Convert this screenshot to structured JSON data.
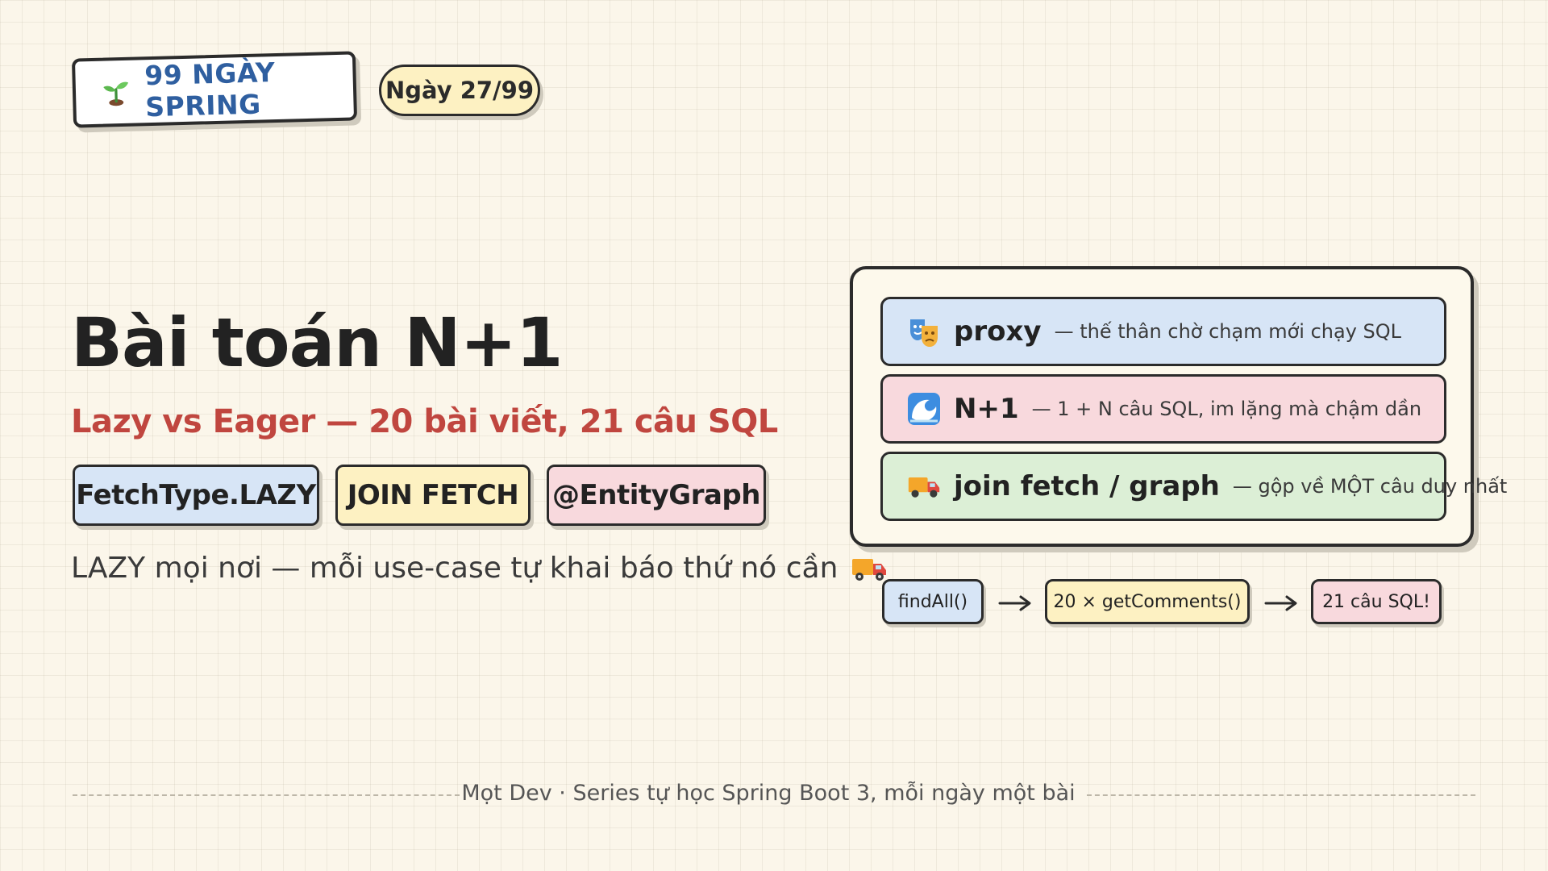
{
  "header": {
    "series_label": "99 NGÀY SPRING",
    "day_label": "Ngày 27/99"
  },
  "main": {
    "title": "Bài toán N+1",
    "subtitle": "Lazy vs Eager — 20 bài viết, 21 câu SQL",
    "chips": [
      "FetchType.LAZY",
      "JOIN FETCH",
      "@EntityGraph"
    ],
    "tagline": "LAZY mọi nơi — mỗi use-case tự khai báo thứ nó cần"
  },
  "panel": {
    "rows": [
      {
        "icon": "theater-masks-icon",
        "keyword": "proxy",
        "description": "— thế thân chờ chạm mới chạy SQL"
      },
      {
        "icon": "wave-icon",
        "keyword": "N+1",
        "description": "— 1 + N câu SQL, im lặng mà chậm dần"
      },
      {
        "icon": "delivery-truck-icon",
        "keyword": "join fetch / graph",
        "description": "— gộp về MỘT câu duy nhất"
      }
    ]
  },
  "flow": {
    "steps": [
      "findAll()",
      "20 × getComments()",
      "21 câu SQL!"
    ]
  },
  "footer": {
    "text": "Mọt Dev · Series tự học Spring Boot 3, mỗi ngày một bài"
  },
  "colors": {
    "background": "#fbf6ea",
    "series_text": "#2f5fa0",
    "subtitle_red": "#c0463f",
    "blue_fill": "#d7e5f6",
    "yellow_fill": "#fdf1c2",
    "pink_fill": "#f8d9dd",
    "green_fill": "#dcefd6"
  }
}
